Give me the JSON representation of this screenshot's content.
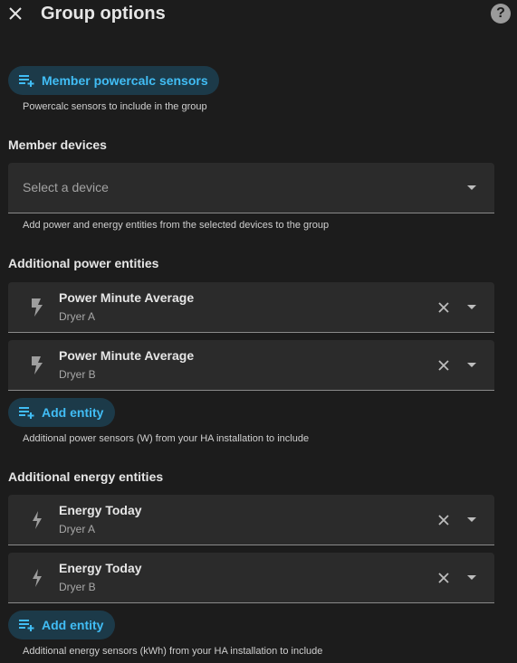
{
  "header": {
    "title": "Group options",
    "help_label": "?"
  },
  "member_powercalc": {
    "button_label": "Member powercalc sensors",
    "helper": "Powercalc sensors to include in the group"
  },
  "member_devices": {
    "title": "Member devices",
    "placeholder": "Select a device",
    "helper": "Add power and energy entities from the selected devices to the group"
  },
  "power_entities": {
    "title": "Additional power entities",
    "items": [
      {
        "name": "Power Minute Average",
        "device": "Dryer A"
      },
      {
        "name": "Power Minute Average",
        "device": "Dryer B"
      }
    ],
    "add_label": "Add entity",
    "helper": "Additional power sensors (W) from your HA installation to include"
  },
  "energy_entities": {
    "title": "Additional energy entities",
    "items": [
      {
        "name": "Energy Today",
        "device": "Dryer A"
      },
      {
        "name": "Energy Today",
        "device": "Dryer B"
      }
    ],
    "add_label": "Add entity",
    "helper": "Additional energy sensors (kWh) from your HA installation to include"
  },
  "colors": {
    "accent": "#41bdf5",
    "background": "#1c1c1c",
    "field": "#2b2b2b"
  }
}
